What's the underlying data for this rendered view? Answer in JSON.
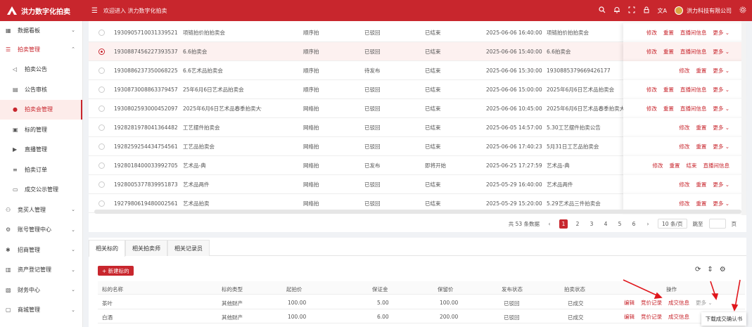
{
  "app": {
    "title": "洪力数字化拍卖",
    "welcome": "欢迎进入 洪力数字化拍卖",
    "company": "洪力科技有限公司"
  },
  "colors": {
    "brand": "#c8262d"
  },
  "icons": [
    "search-icon",
    "bell-icon",
    "fullscreen-icon",
    "lock-icon",
    "translate-icon",
    "gear-icon"
  ],
  "sidebar": {
    "items": [
      {
        "label": "数据看板",
        "icon": "grid-icon",
        "arrow": "⌄"
      },
      {
        "label": "拍卖管理",
        "icon": "list-icon",
        "arrow": "⌃"
      },
      {
        "label": "拍卖公告",
        "icon": "megaphone-icon"
      },
      {
        "label": "公告审核",
        "icon": "audit-icon"
      },
      {
        "label": "拍卖会管理",
        "icon": "clock-icon"
      },
      {
        "label": "标的管理",
        "icon": "box-icon"
      },
      {
        "label": "直播管理",
        "icon": "play-icon"
      },
      {
        "label": "拍卖订单",
        "icon": "order-icon"
      },
      {
        "label": "成交公示管理",
        "icon": "notice-icon"
      },
      {
        "label": "竞买人管理",
        "icon": "user-icon",
        "arrow": "⌄"
      },
      {
        "label": "账号管理中心",
        "icon": "account-icon",
        "arrow": "⌄"
      },
      {
        "label": "招商管理",
        "icon": "business-icon",
        "arrow": "⌄"
      },
      {
        "label": "资产登记管理",
        "icon": "asset-icon",
        "arrow": "⌄"
      },
      {
        "label": "财务中心",
        "icon": "finance-icon",
        "arrow": "⌄"
      },
      {
        "label": "商城管理",
        "icon": "shop-icon",
        "arrow": "⌄"
      }
    ]
  },
  "auction_table": {
    "rows": [
      {
        "id": "1930905710031339521",
        "name": "项链拍价拍拍卖会",
        "method": "顺序拍",
        "audit": "已驳回",
        "status": "已结束",
        "time": "2025-06-06 16:40:00",
        "notice": "项链拍价拍拍卖会",
        "ops": [
          "修改",
          "重置",
          "直播间信息",
          "更多 ⌄"
        ]
      },
      {
        "id": "1930887456227393537",
        "name": "6.6拍卖会",
        "method": "顺序拍",
        "audit": "已驳回",
        "status": "已结束",
        "time": "2025-06-06 15:40:00",
        "notice": "6.6拍卖会",
        "ops": [
          "修改",
          "重置",
          "直播间信息",
          "更多 ⌄"
        ]
      },
      {
        "id": "1930886237350068225",
        "name": "6.6艺术品拍卖会",
        "method": "顺序拍",
        "audit": "待发布",
        "status": "已结束",
        "time": "2025-06-06 15:30:00",
        "notice": "1930885379669426177",
        "ops": [
          "修改",
          "重置",
          "更多 ⌄"
        ]
      },
      {
        "id": "1930873008863379457",
        "name": "25年6月6日艺术品拍卖会",
        "method": "顺序拍",
        "audit": "已驳回",
        "status": "已结束",
        "time": "2025-06-06 15:00:00",
        "notice": "2025年6月6日艺术品拍卖会",
        "ops": [
          "修改",
          "重置",
          "直播间信息",
          "更多 ⌄"
        ]
      },
      {
        "id": "1930802593000452097",
        "name": "2025年6月6日艺术品春季拍卖大会",
        "method": "网络拍",
        "audit": "已驳回",
        "status": "已结束",
        "time": "2025-06-06 10:45:00",
        "notice": "2025年6月6日艺术品春季拍卖大",
        "ops": [
          "修改",
          "重置",
          "直播间信息",
          "更多 ⌄"
        ]
      },
      {
        "id": "1928281978041364482",
        "name": "工艺摆件拍卖会",
        "method": "网络拍",
        "audit": "已驳回",
        "status": "已结束",
        "time": "2025-06-05 14:57:00",
        "notice": "5.30工艺摆件拍卖公告",
        "ops": [
          "修改",
          "重置",
          "更多 ⌄"
        ]
      },
      {
        "id": "1928259254434754561",
        "name": "工艺品拍卖会",
        "method": "网络拍",
        "audit": "已驳回",
        "status": "已结束",
        "time": "2025-06-06 17:40:23",
        "notice": "5月31日工艺品拍卖会",
        "ops": [
          "修改",
          "重置",
          "更多 ⌄"
        ]
      },
      {
        "id": "1928018400033992705",
        "name": "艺术品-典",
        "method": "网络拍",
        "audit": "已发布",
        "status": "即将开始",
        "time": "2025-06-25 17:27:59",
        "notice": "艺术品-典",
        "ops": [
          "修改",
          "重置",
          "结束",
          "直播间信息"
        ]
      },
      {
        "id": "1928005377839951873",
        "name": "艺术品两件",
        "method": "网络拍",
        "audit": "已驳回",
        "status": "已结束",
        "time": "2025-05-29 16:40:00",
        "notice": "艺术品两件",
        "ops": [
          "修改",
          "重置",
          "更多 ⌄"
        ]
      },
      {
        "id": "1927980619480002561",
        "name": "艺术品拍卖",
        "method": "网络拍",
        "audit": "已驳回",
        "status": "已结束",
        "time": "2025-05-29 15:20:00",
        "notice": "5.29艺术品三件拍卖会",
        "ops": [
          "修改",
          "重置",
          "更多 ⌄"
        ]
      }
    ]
  },
  "pager": {
    "total": "共 53 条数据",
    "pages": [
      "1",
      "2",
      "3",
      "4",
      "5",
      "6"
    ],
    "current": "1",
    "prev": "‹",
    "next": "›",
    "size": "10 条/页",
    "jump": "跳至",
    "page_unit": "页"
  },
  "tabs": [
    "相关标的",
    "相关拍卖师",
    "相关记录员"
  ],
  "lots": {
    "new_button": "+ 新建标的",
    "headers": [
      "标的名称",
      "标的类型",
      "起拍价",
      "保证金",
      "保留价",
      "发布状态",
      "拍卖状态",
      "操作"
    ],
    "rows": [
      {
        "name": "茶叶",
        "type": "其他财产",
        "start": "100.00",
        "deposit": "5.00",
        "reserve": "100.00",
        "publish": "已驳回",
        "auction": "已成交",
        "ops": [
          "编辑",
          "竞价记录",
          "成交信息",
          "更多 ⌄"
        ]
      },
      {
        "name": "白酒",
        "type": "其他财产",
        "start": "100.00",
        "deposit": "6.00",
        "reserve": "200.00",
        "publish": "已驳回",
        "auction": "已成交",
        "ops": [
          "编辑",
          "竞价记录",
          "成交信息"
        ]
      }
    ]
  },
  "popup": {
    "label": "下载成交确认书"
  }
}
